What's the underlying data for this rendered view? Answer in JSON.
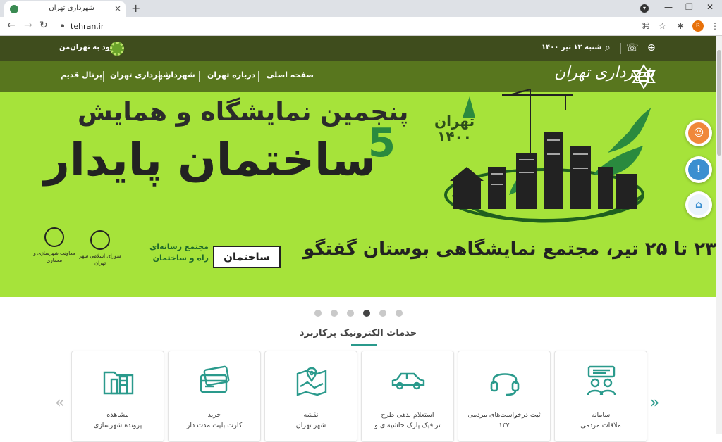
{
  "browser": {
    "tab_title": "شهرداری تهران",
    "url": "tehran.ir",
    "profile_initial": "R",
    "new_tab": "+",
    "close": "×"
  },
  "topbar": {
    "date": "شنبه ۱۲ تیر ۱۴۰۰",
    "login": "ورود به تهران‌من"
  },
  "nav": {
    "items": [
      "صفحه اصلی",
      "درباره تهران",
      "شهردار",
      "شهرداری تهران",
      "پرتال قدیم"
    ],
    "logo_text": "شهرداری تهران"
  },
  "hero": {
    "line1": "پنجمین نمایشگاه و همایش",
    "line2": "ساختمان پایدار",
    "number": "5",
    "tehran_year_top": "تهران",
    "tehran_year_bottom": "۱۴۰۰",
    "dates": "۲۳ تا ۲۵ تیر، مجتمع نمایشگاهی بوستان گفتگو",
    "sponsor_magazine": "ساختمان",
    "sponsor_media_line1": "مجتمع رسانه‌ای",
    "sponsor_media_line2": "راه و ساختمان",
    "sponsor_council": "شورای اسلامی شهر تهران",
    "sponsor_vice": "معاونت شهرسازی و معماری"
  },
  "carousel": {
    "count": 6,
    "active_index": 3
  },
  "services": {
    "title": "خدمات الکترونیک پرکاربرد",
    "cards": [
      {
        "icon": "people-icon",
        "line1": "سامانه",
        "line2": "ملاقات مردمی"
      },
      {
        "icon": "headset-icon",
        "line1": "ثبت درخواست‌های مردمی",
        "line2": "۱۳۷"
      },
      {
        "icon": "car-icon",
        "line1": "استعلام بدهی طرح",
        "line2": "ترافیک پارک حاشیه‌ای و"
      },
      {
        "icon": "map-pin-icon",
        "line1": "نقشه",
        "line2": "شهر تهران"
      },
      {
        "icon": "ticket-card-icon",
        "line1": "خرید",
        "line2": "کارت بلیت مدت دار"
      },
      {
        "icon": "folder-city-icon",
        "line1": "مشاهده",
        "line2": "پرونده شهرسازی"
      }
    ],
    "prev_arrow": "«",
    "next_arrow": "»"
  },
  "colors": {
    "topbar": "#3f4d1d",
    "hero_bg": "#a6e33a",
    "accent": "#2a9a8c",
    "green_dark": "#2a8a3e"
  }
}
